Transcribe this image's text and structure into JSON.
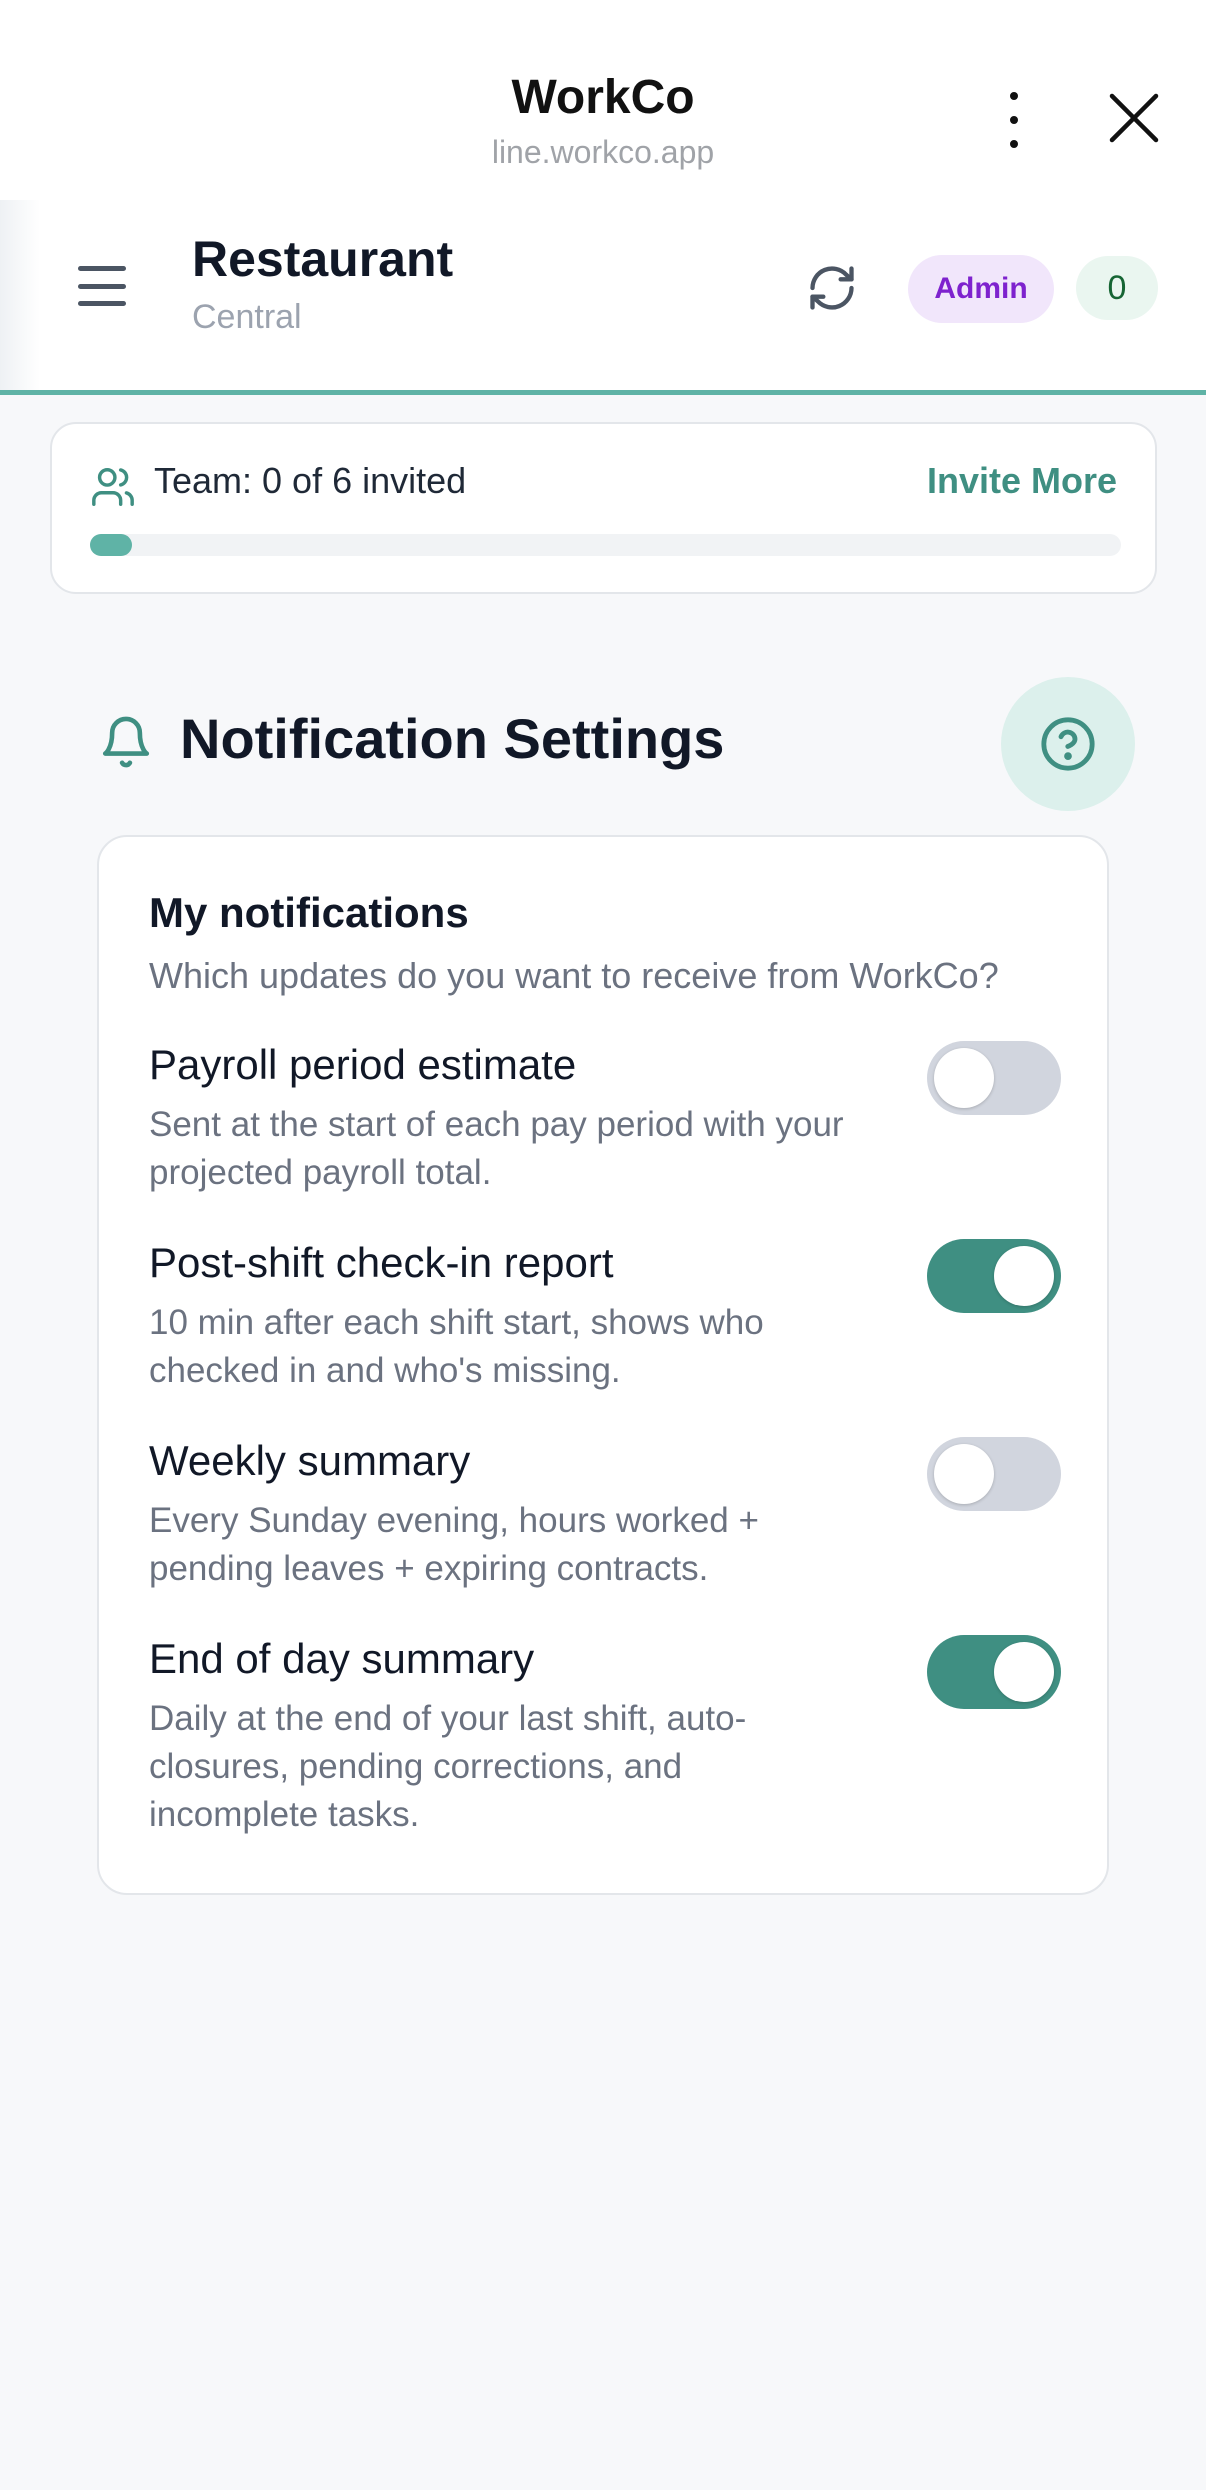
{
  "browser": {
    "title": "WorkCo",
    "url": "line.workco.app"
  },
  "header": {
    "store_name": "Restaurant",
    "store_location": "Central",
    "role_badge": "Admin",
    "count_badge": "0"
  },
  "team": {
    "status_text": "Team: 0 of 6 invited",
    "invite_label": "Invite More",
    "invited_fraction": 0.0
  },
  "notifications": {
    "section_title": "Notification Settings",
    "card_title": "My notifications",
    "card_subtitle": "Which updates do you want to receive from WorkCo?",
    "settings": [
      {
        "label": "Payroll period estimate",
        "description": "Sent at the start of each pay period with your projected payroll total.",
        "enabled": false
      },
      {
        "label": "Post-shift check-in report",
        "description": "10 min after each shift start, shows who checked in and who's missing.",
        "enabled": true
      },
      {
        "label": "Weekly summary",
        "description": "Every Sunday evening, hours worked + pending leaves + expiring contracts.",
        "enabled": false
      },
      {
        "label": "End of day summary",
        "description": "Daily at the end of your last shift, auto-closures, pending corrections, and incomplete tasks.",
        "enabled": true
      }
    ]
  },
  "colors": {
    "accent": "#3f8f82",
    "accent_light": "#5fb3a6",
    "admin_badge_text": "#7e22ce",
    "admin_badge_bg": "#f1e6fb"
  }
}
